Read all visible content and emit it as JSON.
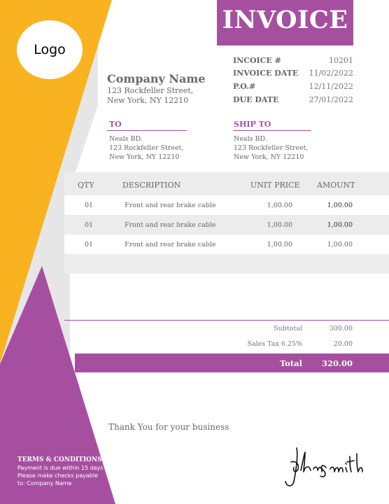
{
  "colors": {
    "purple": "#a64fa0",
    "orange": "#f9b320",
    "gray": "#e6e6e6",
    "table_gray": "#ececec"
  },
  "logo": {
    "text": "Logo"
  },
  "title": "INVOICE",
  "meta": [
    {
      "label": "INCOICE #",
      "value": "10201"
    },
    {
      "label": "INVOICE DATE",
      "value": "11/02/2022"
    },
    {
      "label": "P.O.#",
      "value": "12/11/2022"
    },
    {
      "label": "DUE DATE",
      "value": "27/01/2022"
    }
  ],
  "company": {
    "name": "Company Name",
    "lines": [
      "123 Rockfeller Street,",
      "New York, NY 12210"
    ]
  },
  "bill_to": {
    "heading": "TO",
    "lines": [
      "Neals BD.",
      "123 Rockfeller Street,",
      "New York, NY 12210"
    ]
  },
  "ship_to": {
    "heading": "SHIP TO",
    "lines": [
      "Neals BD.",
      "123 Rockfeller Street,",
      "New York, NY 12210"
    ]
  },
  "table": {
    "headers": {
      "qty": "QTY",
      "description": "DESCRIPTION",
      "unit_price": "UNIT PRICE",
      "amount": "AMOUNT"
    },
    "rows": [
      {
        "qty": "01",
        "description": "Front and rear brake cable",
        "unit_price": "1,00.00",
        "amount": "1,00.00"
      },
      {
        "qty": "01",
        "description": "Front and rear brake cable",
        "unit_price": "1,00.00",
        "amount": "1,00.00"
      },
      {
        "qty": "01",
        "description": "Front and rear brake cable",
        "unit_price": "1,00.00",
        "amount": "1,00.00"
      }
    ]
  },
  "totals": {
    "subtotal_label": "Subtotal",
    "subtotal": "300.00",
    "tax_label": "Sales Tax 6.25%",
    "tax": "20.00",
    "total_label": "Total",
    "total": "320.00"
  },
  "thanks": "Thank You for your business",
  "terms": {
    "heading": "TERMS & CONDITIONS",
    "lines": [
      "Payment is due within 15 days",
      "Please make checks payable",
      "to: Company Name"
    ]
  },
  "signature": {
    "text": "John Smith"
  }
}
